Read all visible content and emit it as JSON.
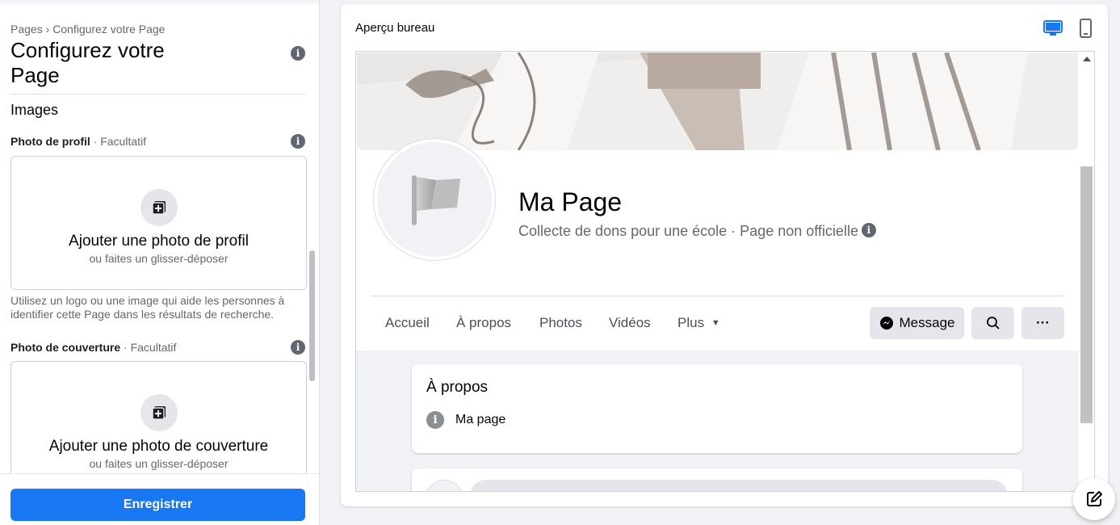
{
  "sidebar": {
    "breadcrumb": "Pages › Configurez votre Page",
    "title": "Configurez votre Page",
    "section_heading": "Images",
    "profile_photo": {
      "label": "Photo de profil",
      "optional": " · Facultatif",
      "cta": "Ajouter une photo de profil",
      "sub": "ou faites un glisser-déposer"
    },
    "helper_text": "Utilisez un logo ou une image qui aide les personnes à identifier cette Page dans les résultats de recherche.",
    "cover_photo": {
      "label": "Photo de couverture",
      "optional": " · Facultatif",
      "cta": "Ajouter une photo de couverture",
      "sub": "ou faites un glisser-déposer"
    },
    "save_label": "Enregistrer"
  },
  "preview": {
    "title": "Aperçu bureau",
    "page_name": "Ma Page",
    "page_subtitle": "Collecte de dons pour une école · Page non officielle",
    "tabs": [
      "Accueil",
      "À propos",
      "Photos",
      "Vidéos",
      "Plus"
    ],
    "message_label": "Message",
    "more_label": "···",
    "about": {
      "title": "À propos",
      "row": "Ma page"
    }
  },
  "colors": {
    "accent": "#1877f2",
    "info_icon": "#606770"
  }
}
